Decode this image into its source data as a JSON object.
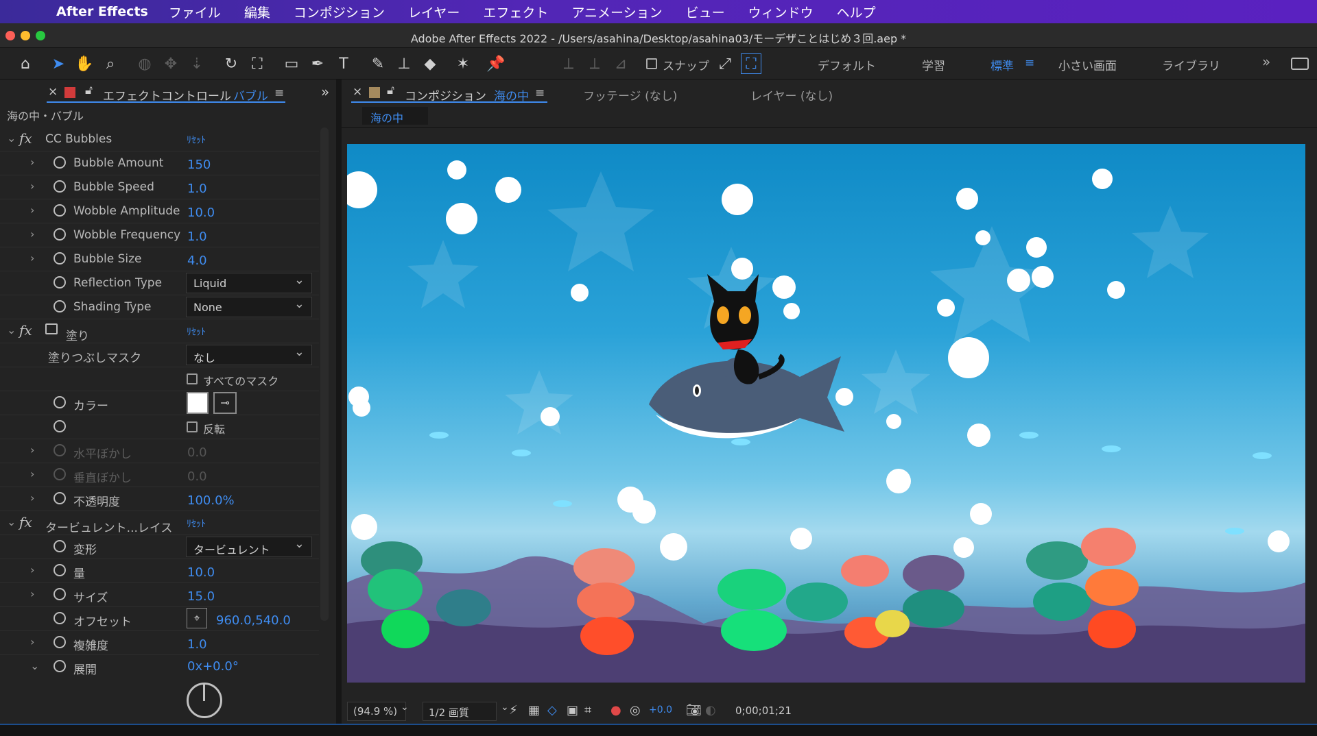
{
  "menubar": {
    "app_name": "After Effects",
    "items": [
      "ファイル",
      "編集",
      "コンポジション",
      "レイヤー",
      "エフェクト",
      "アニメーション",
      "ビュー",
      "ウィンドウ",
      "ヘルプ"
    ]
  },
  "window": {
    "title": "Adobe After Effects 2022 - /Users/asahina/Desktop/asahina03/モーデザことはじめ３回.aep *"
  },
  "toolbar": {
    "snap_label": "スナップ",
    "workspaces": [
      "デフォルト",
      "学習",
      "標準",
      "小さい画面",
      "ライブラリ"
    ],
    "active_workspace": "標準"
  },
  "effect_panel": {
    "tab_prefix": "エフェクトコントロール",
    "tab_layer": "バブル",
    "breadcrumb": "海の中・バブル",
    "reset": "ﾘｾｯﾄ",
    "effects": {
      "cc_bubbles": {
        "name": "CC Bubbles",
        "bubble_amount": {
          "label": "Bubble Amount",
          "value": "150"
        },
        "bubble_speed": {
          "label": "Bubble Speed",
          "value": "1.0"
        },
        "wobble_amplitude": {
          "label": "Wobble Amplitude",
          "value": "10.0"
        },
        "wobble_frequency": {
          "label": "Wobble Frequency",
          "value": "1.0"
        },
        "bubble_size": {
          "label": "Bubble Size",
          "value": "4.0"
        },
        "reflection_type": {
          "label": "Reflection Type",
          "value": "Liquid"
        },
        "shading_type": {
          "label": "Shading Type",
          "value": "None"
        }
      },
      "fill": {
        "name": "塗り",
        "mask_label": "塗りつぶしマスク",
        "mask_value": "なし",
        "all_masks": "すべてのマスク",
        "color_label": "カラー",
        "invert": "反転",
        "h_feather": {
          "label": "水平ぼかし",
          "value": "0.0"
        },
        "v_feather": {
          "label": "垂直ぼかし",
          "value": "0.0"
        },
        "opacity": {
          "label": "不透明度",
          "value": "100.0%"
        }
      },
      "turbulent": {
        "name": "タービュレント...レイス",
        "displacement": {
          "label": "変形",
          "value": "タービュレント"
        },
        "amount": {
          "label": "量",
          "value": "10.0"
        },
        "size": {
          "label": "サイズ",
          "value": "15.0"
        },
        "offset": {
          "label": "オフセット",
          "value": "960.0,540.0"
        },
        "complexity": {
          "label": "複雑度",
          "value": "1.0"
        },
        "evolution": {
          "label": "展開",
          "value": "0x+0.0°"
        }
      }
    }
  },
  "comp_panel": {
    "tab_prefix": "コンポジション",
    "tab_comp": "海の中",
    "footage_tab": "フッテージ (なし)",
    "layer_tab": "レイヤー (なし)",
    "comp_chip": "海の中",
    "zoom": "(94.9 %)",
    "resolution": "1/2 画質",
    "exposure": "+0.0",
    "timecode": "0;00;01;21"
  },
  "colors": {
    "accent": "#3f8cf0",
    "menubar": "#5226b6",
    "ocean_top": "#0f8ac6"
  }
}
